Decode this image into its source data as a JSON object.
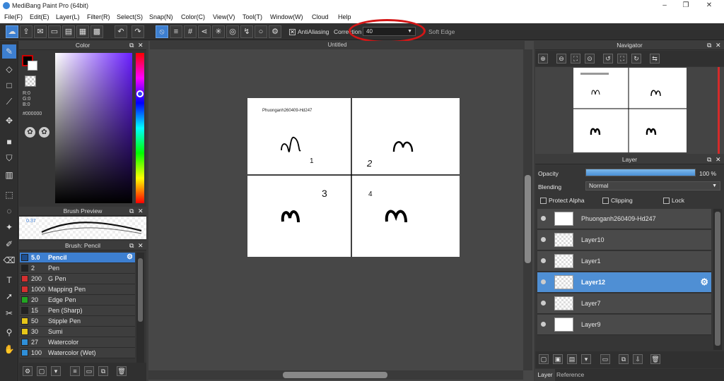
{
  "window": {
    "title": "MediBang Paint Pro (64bit)",
    "min": "–",
    "max": "❐",
    "close": "✕"
  },
  "menu": [
    "File(F)",
    "Edit(E)",
    "Layer(L)",
    "Filter(R)",
    "Select(S)",
    "Snap(N)",
    "Color(C)",
    "View(V)",
    "Tool(T)",
    "Window(W)",
    "Cloud",
    "Help"
  ],
  "toolbar": {
    "antialiasing": "AntiAliasing",
    "antialiasing_checked": true,
    "correction_label": "Correction",
    "correction_value": "40",
    "soft_edge": "Soft Edge"
  },
  "color_panel": {
    "title": "Color",
    "r": "R:0",
    "g": "G:0",
    "b": "B:0",
    "hex": "#000000",
    "fg_color": "#000000",
    "bg_color": "#ffffff"
  },
  "brush_preview": {
    "title": "Brush Preview",
    "size": "0.37"
  },
  "brush_panel": {
    "title": "Brush: Pencil",
    "items": [
      {
        "size": "5.0",
        "name": "Pencil",
        "color": "#1e4f8f",
        "selected": true
      },
      {
        "size": "2",
        "name": "Pen",
        "color": "#222222"
      },
      {
        "size": "200",
        "name": "G Pen",
        "color": "#d43030"
      },
      {
        "size": "1000",
        "name": "Mapping Pen",
        "color": "#d43030"
      },
      {
        "size": "20",
        "name": "Edge Pen",
        "color": "#22a522"
      },
      {
        "size": "15",
        "name": "Pen (Sharp)",
        "color": "#222222"
      },
      {
        "size": "50",
        "name": "Stipple Pen",
        "color": "#e6c619"
      },
      {
        "size": "30",
        "name": "Sumi",
        "color": "#e6c619"
      },
      {
        "size": "27",
        "name": "Watercolor",
        "color": "#2f8fd8"
      },
      {
        "size": "100",
        "name": "Watercolor (Wet)",
        "color": "#2f8fd8"
      }
    ]
  },
  "document": {
    "tab": "Untitled",
    "canvas_text": "Phuonganh260409-Hd247",
    "numbers": [
      "1",
      "2",
      "3",
      "4"
    ]
  },
  "navigator": {
    "title": "Navigator"
  },
  "layer_panel": {
    "title": "Layer",
    "opacity_label": "Opacity",
    "opacity_value": "100 %",
    "opacity_fraction": 1.0,
    "blending_label": "Blending",
    "blending_value": "Normal",
    "protect_alpha": "Protect Alpha",
    "clipping": "Clipping",
    "lock": "Lock",
    "layers": [
      {
        "name": "Phuonganh260409-Hd247"
      },
      {
        "name": "Layer10"
      },
      {
        "name": "Layer1"
      },
      {
        "name": "Layer12",
        "selected": true
      },
      {
        "name": "Layer7"
      },
      {
        "name": "Layer9"
      }
    ],
    "tabs": [
      "Layer",
      "Reference"
    ]
  }
}
